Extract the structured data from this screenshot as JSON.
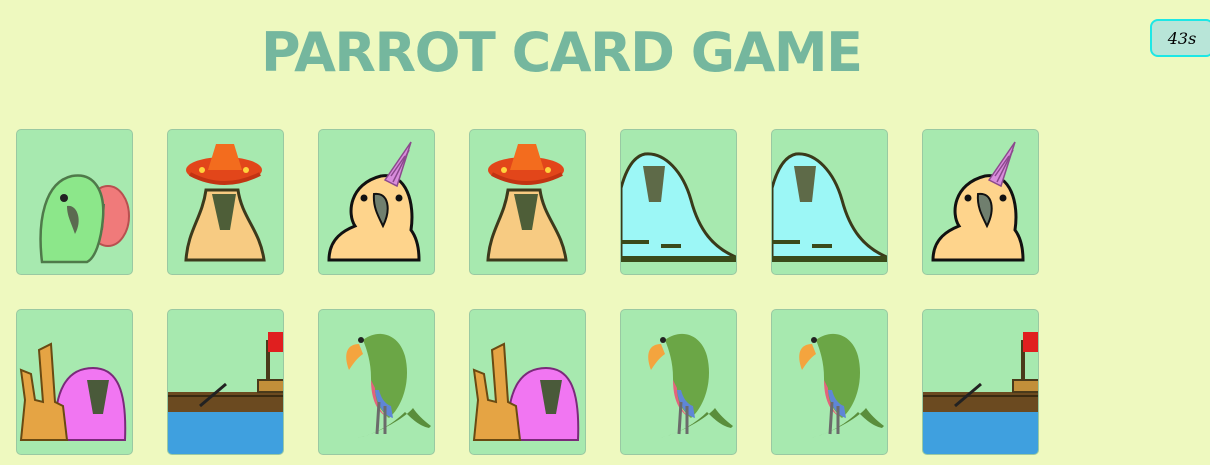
{
  "game": {
    "title": "PARROT CARD GAME",
    "timer": "43s"
  },
  "colors": {
    "background": "#EEF9BF",
    "title": "#75B79E",
    "card_back": "#A7E9AF",
    "timer_bg": "#B8E5D8",
    "timer_border": "#1DE7E5"
  },
  "cards": [
    {
      "parrot": "party-parrot-green",
      "flipped": true
    },
    {
      "parrot": "fiesta-parrot",
      "flipped": true
    },
    {
      "parrot": "unicorn-parrot",
      "flipped": true
    },
    {
      "parrot": "fiesta-parrot",
      "flipped": true
    },
    {
      "parrot": "explody-parrot",
      "flipped": true
    },
    {
      "parrot": "explody-parrot",
      "flipped": true
    },
    {
      "parrot": "unicorn-parrot",
      "flipped": true
    },
    {
      "parrot": "metal-parrot",
      "flipped": true
    },
    {
      "parrot": "ship-parrot",
      "flipped": true
    },
    {
      "parrot": "bob-parrot",
      "flipped": true
    },
    {
      "parrot": "metal-parrot",
      "flipped": true
    },
    {
      "parrot": "bob-parrot",
      "flipped": true
    },
    {
      "parrot": "bob-parrot",
      "flipped": true
    },
    {
      "parrot": "ship-parrot",
      "flipped": true
    }
  ]
}
